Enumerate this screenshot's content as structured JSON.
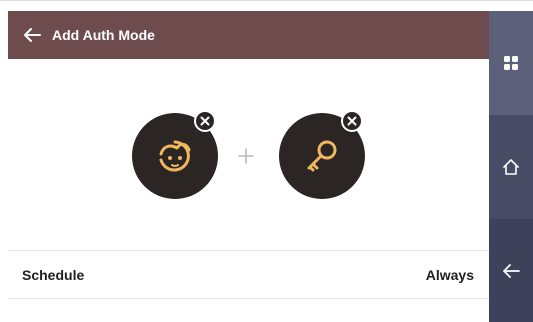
{
  "header": {
    "title": "Add Auth Mode"
  },
  "auth_mode": {
    "items": [
      {
        "type": "face",
        "icon": "face-icon",
        "remove_icon": "close-icon"
      },
      {
        "type": "card",
        "icon": "key-icon",
        "remove_icon": "close-icon"
      }
    ],
    "separator": "+"
  },
  "schedule": {
    "label": "Schedule",
    "value": "Always"
  },
  "sidebar": {
    "buttons": [
      {
        "name": "apps",
        "icon": "grid-icon"
      },
      {
        "name": "home",
        "icon": "home-icon"
      },
      {
        "name": "back",
        "icon": "back-arrow-icon"
      }
    ]
  },
  "colors": {
    "header_bg": "#6e4c4e",
    "icon_accent": "#f0b75e",
    "circle_bg": "#2b2523",
    "sidebar_bg": "#474c64",
    "sidebar_top_bg": "#5c6179"
  }
}
